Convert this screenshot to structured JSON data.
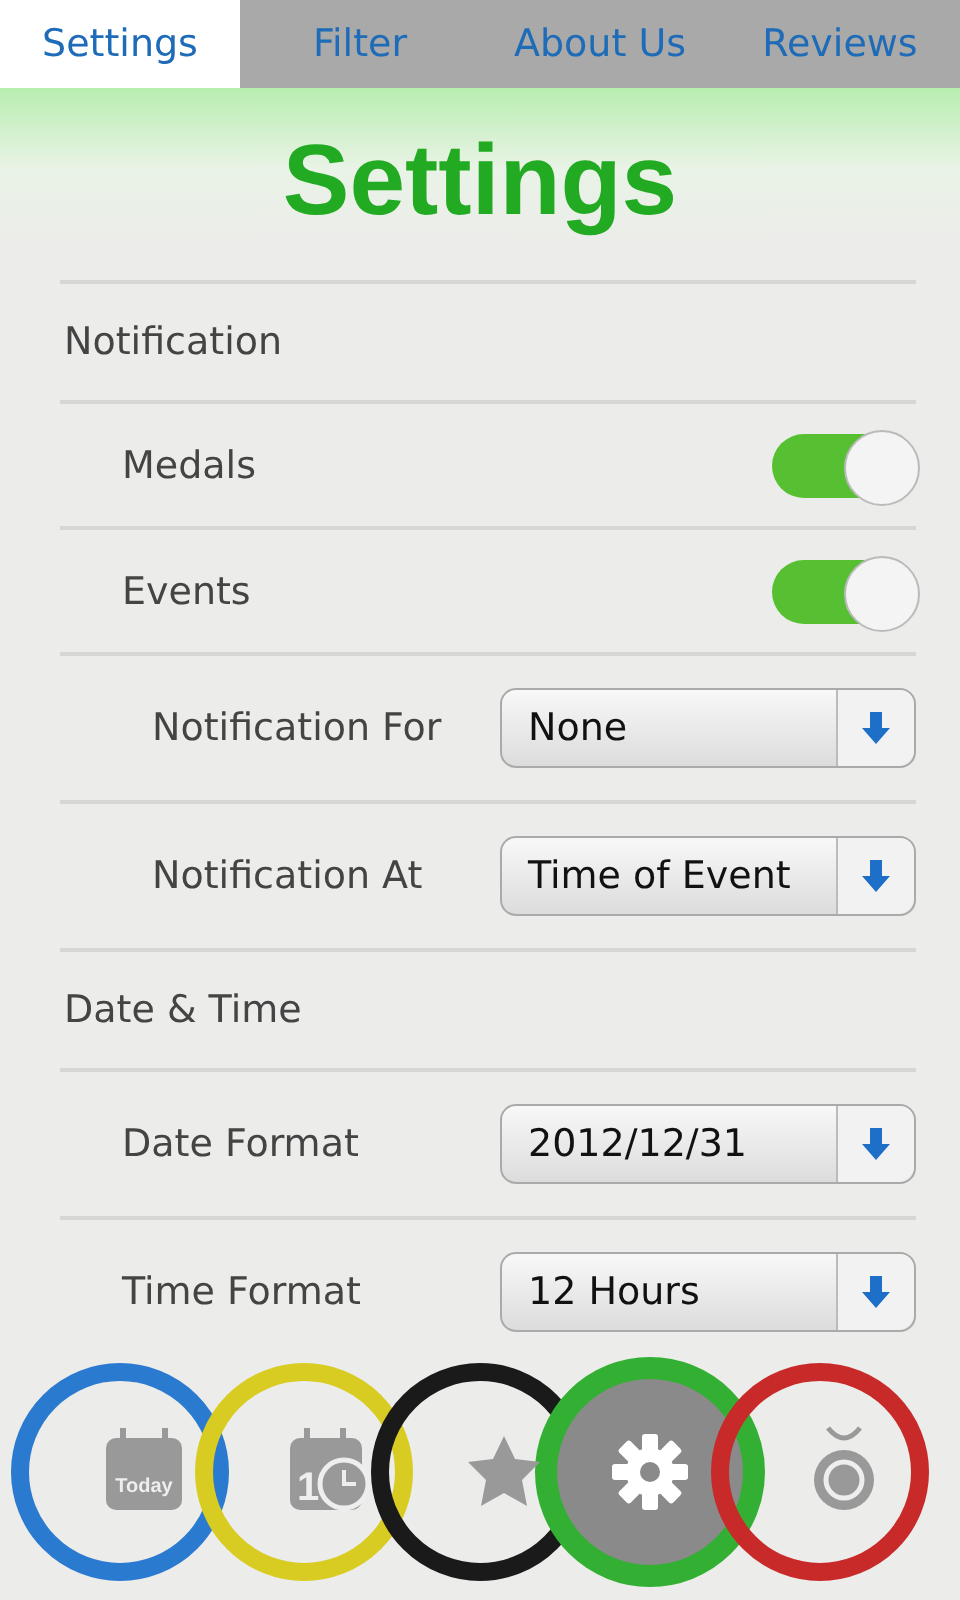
{
  "tabs": [
    {
      "label": "Settings",
      "selected": true
    },
    {
      "label": "Filter",
      "selected": false
    },
    {
      "label": "About Us",
      "selected": false
    },
    {
      "label": "Reviews",
      "selected": false
    }
  ],
  "title": "Settings",
  "sections": [
    {
      "label": "Notification",
      "children": [
        {
          "kind": "toggle",
          "label": "Medals",
          "on": true
        },
        {
          "kind": "toggle",
          "label": "Events",
          "on": true,
          "children": [
            {
              "kind": "dropdown",
              "label": "Notification For",
              "value": "None"
            },
            {
              "kind": "dropdown",
              "label": "Notification At",
              "value": "Time of Event"
            }
          ]
        }
      ]
    },
    {
      "label": "Date & Time",
      "children": [
        {
          "kind": "dropdown",
          "label": "Date Format",
          "value": "2012/12/31"
        },
        {
          "kind": "dropdown",
          "label": "Time Format",
          "value": "12 Hours"
        }
      ]
    }
  ],
  "nav": [
    {
      "kind": "today",
      "color": "#2a7ad0",
      "icon_text": "Today",
      "selected": false
    },
    {
      "kind": "calendar-clock",
      "color": "#d8cc22",
      "icon_text": "1",
      "selected": false
    },
    {
      "kind": "star",
      "color": "#1a1a1a",
      "selected": false
    },
    {
      "kind": "gear",
      "color": "#33b033",
      "selected": true
    },
    {
      "kind": "medal",
      "color": "#c82a2a",
      "selected": false
    }
  ]
}
